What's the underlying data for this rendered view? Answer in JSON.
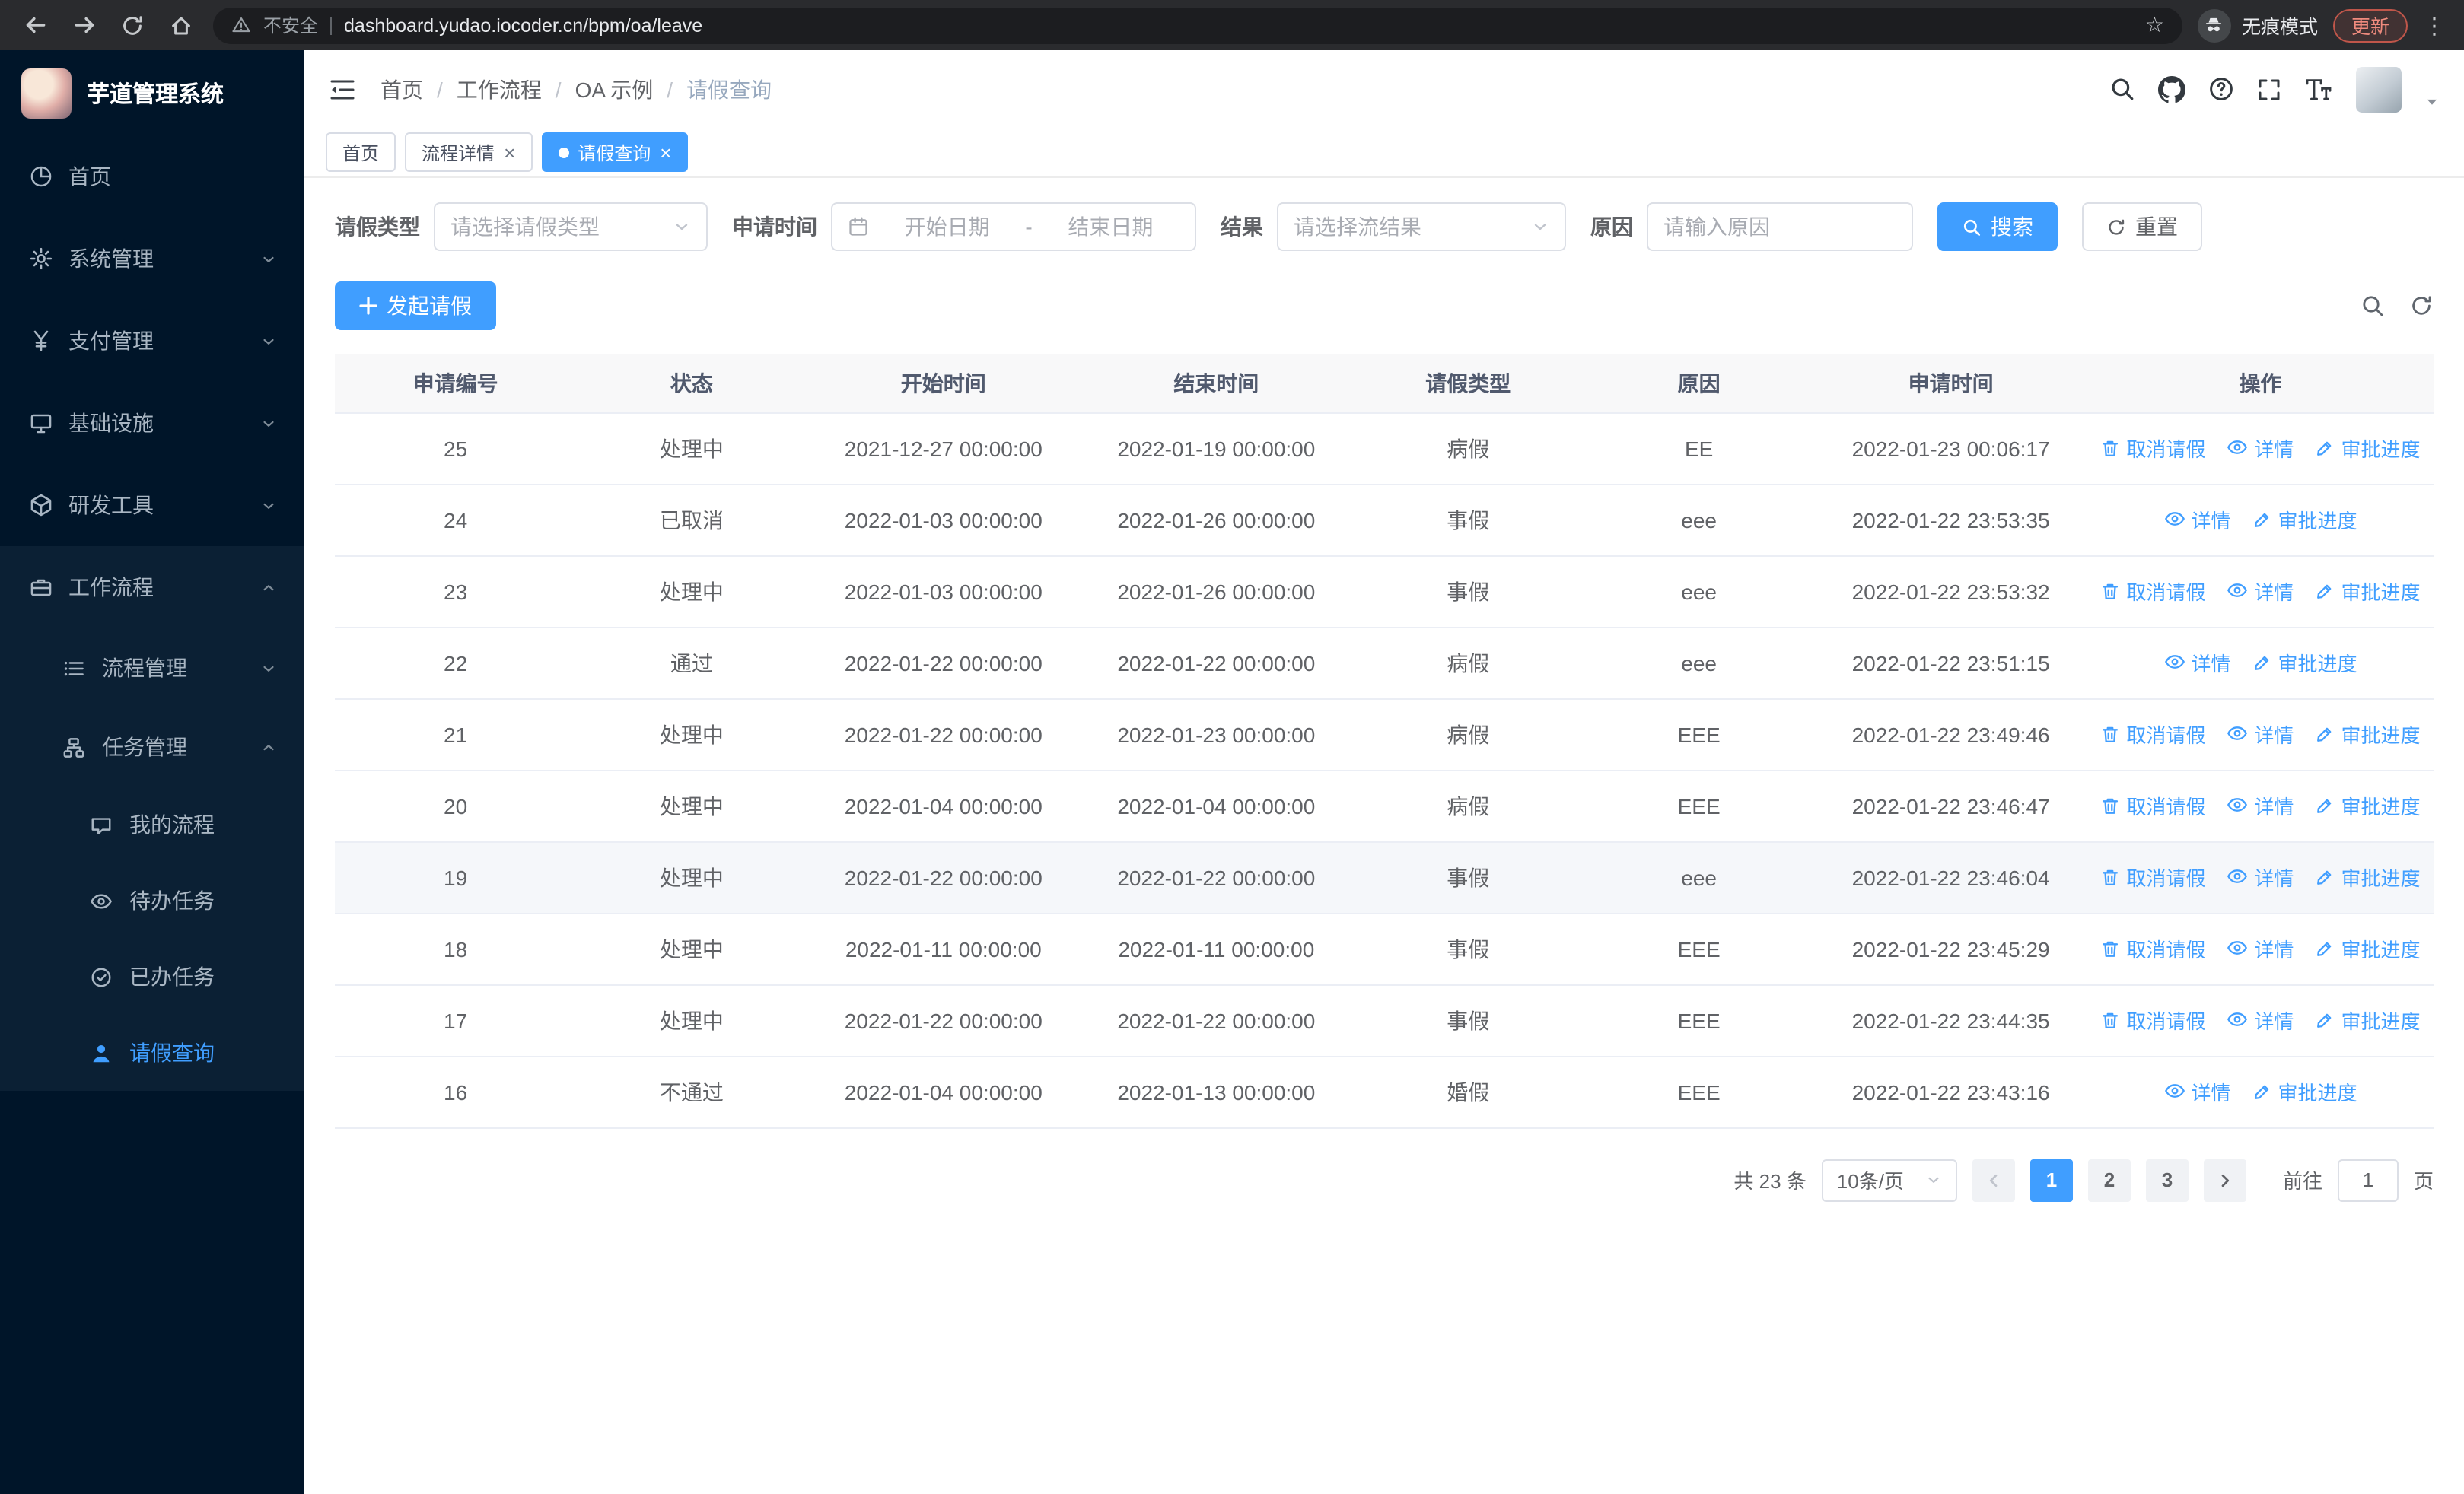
{
  "browser": {
    "security_label": "不安全",
    "url": "dashboard.yudao.iocoder.cn/bpm/oa/leave",
    "incognito_label": "无痕模式",
    "update_label": "更新"
  },
  "icons": {
    "close": "×",
    "kebab": "⋮",
    "star": "☆"
  },
  "sidebar": {
    "app_title": "芋道管理系统",
    "items": [
      {
        "label": "首页",
        "icon": "dashboard-icon"
      },
      {
        "label": "系统管理",
        "icon": "gear-icon"
      },
      {
        "label": "支付管理",
        "icon": "yen-icon"
      },
      {
        "label": "基础设施",
        "icon": "monitor-icon"
      },
      {
        "label": "研发工具",
        "icon": "cube-icon"
      },
      {
        "label": "工作流程",
        "icon": "briefcase-icon",
        "expanded": true
      }
    ],
    "workflow_children": [
      {
        "label": "流程管理",
        "icon": "list-icon"
      },
      {
        "label": "任务管理",
        "icon": "hierarchy-icon",
        "expanded": true
      }
    ],
    "task_children": [
      {
        "label": "我的流程",
        "icon": "chat-icon"
      },
      {
        "label": "待办任务",
        "icon": "eye-icon"
      },
      {
        "label": "已办任务",
        "icon": "check-circle-icon"
      },
      {
        "label": "请假查询",
        "icon": "user-icon",
        "active": true
      }
    ]
  },
  "header": {
    "breadcrumb": [
      "首页",
      "工作流程",
      "OA 示例",
      "请假查询"
    ]
  },
  "tabs": [
    {
      "label": "首页",
      "closable": false,
      "active": false
    },
    {
      "label": "流程详情",
      "closable": true,
      "active": false
    },
    {
      "label": "请假查询",
      "closable": true,
      "active": true
    }
  ],
  "filters": {
    "leave_type_label": "请假类型",
    "leave_type_placeholder": "请选择请假类型",
    "apply_time_label": "申请时间",
    "start_placeholder": "开始日期",
    "separator": "-",
    "end_placeholder": "结束日期",
    "result_label": "结果",
    "result_placeholder": "请选择流结果",
    "reason_label": "原因",
    "reason_placeholder": "请输入原因",
    "search_label": "搜索",
    "reset_label": "重置"
  },
  "toolbar": {
    "create_label": "发起请假"
  },
  "table": {
    "headers": [
      "申请编号",
      "状态",
      "开始时间",
      "结束时间",
      "请假类型",
      "原因",
      "申请时间",
      "操作"
    ],
    "action_labels": {
      "cancel": "取消请假",
      "detail": "详情",
      "progress": "审批进度"
    },
    "rows": [
      {
        "id": "25",
        "status": "处理中",
        "start": "2021-12-27 00:00:00",
        "end": "2022-01-19 00:00:00",
        "type": "病假",
        "reason": "EE",
        "applied": "2022-01-23 00:06:17",
        "cancellable": true,
        "highlighted": false
      },
      {
        "id": "24",
        "status": "已取消",
        "start": "2022-01-03 00:00:00",
        "end": "2022-01-26 00:00:00",
        "type": "事假",
        "reason": "eee",
        "applied": "2022-01-22 23:53:35",
        "cancellable": false,
        "highlighted": false
      },
      {
        "id": "23",
        "status": "处理中",
        "start": "2022-01-03 00:00:00",
        "end": "2022-01-26 00:00:00",
        "type": "事假",
        "reason": "eee",
        "applied": "2022-01-22 23:53:32",
        "cancellable": true,
        "highlighted": false
      },
      {
        "id": "22",
        "status": "通过",
        "start": "2022-01-22 00:00:00",
        "end": "2022-01-22 00:00:00",
        "type": "病假",
        "reason": "eee",
        "applied": "2022-01-22 23:51:15",
        "cancellable": false,
        "highlighted": false
      },
      {
        "id": "21",
        "status": "处理中",
        "start": "2022-01-22 00:00:00",
        "end": "2022-01-23 00:00:00",
        "type": "病假",
        "reason": "EEE",
        "applied": "2022-01-22 23:49:46",
        "cancellable": true,
        "highlighted": false
      },
      {
        "id": "20",
        "status": "处理中",
        "start": "2022-01-04 00:00:00",
        "end": "2022-01-04 00:00:00",
        "type": "病假",
        "reason": "EEE",
        "applied": "2022-01-22 23:46:47",
        "cancellable": true,
        "highlighted": false
      },
      {
        "id": "19",
        "status": "处理中",
        "start": "2022-01-22 00:00:00",
        "end": "2022-01-22 00:00:00",
        "type": "事假",
        "reason": "eee",
        "applied": "2022-01-22 23:46:04",
        "cancellable": true,
        "highlighted": true
      },
      {
        "id": "18",
        "status": "处理中",
        "start": "2022-01-11 00:00:00",
        "end": "2022-01-11 00:00:00",
        "type": "事假",
        "reason": "EEE",
        "applied": "2022-01-22 23:45:29",
        "cancellable": true,
        "highlighted": false
      },
      {
        "id": "17",
        "status": "处理中",
        "start": "2022-01-22 00:00:00",
        "end": "2022-01-22 00:00:00",
        "type": "事假",
        "reason": "EEE",
        "applied": "2022-01-22 23:44:35",
        "cancellable": true,
        "highlighted": false
      },
      {
        "id": "16",
        "status": "不通过",
        "start": "2022-01-04 00:00:00",
        "end": "2022-01-13 00:00:00",
        "type": "婚假",
        "reason": "EEE",
        "applied": "2022-01-22 23:43:16",
        "cancellable": false,
        "highlighted": false
      }
    ]
  },
  "pagination": {
    "total_label": "共 23 条",
    "page_size_label": "10条/页",
    "pages": [
      "1",
      "2",
      "3"
    ],
    "active_page": "1",
    "goto_label": "前往",
    "goto_value": "1",
    "page_unit_label": "页"
  },
  "colors": {
    "accent": "#409eff",
    "sidebar_bg": "#001529"
  }
}
